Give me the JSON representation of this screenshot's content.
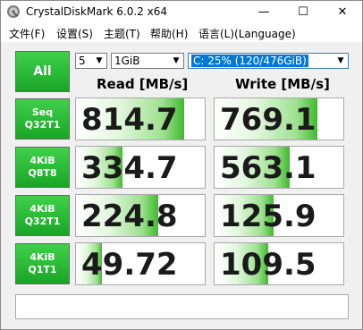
{
  "window": {
    "title": "CrystalDiskMark 6.0.2 x64"
  },
  "titlebar_buttons": {
    "minimize": "—",
    "maximize": "☐",
    "close": "✕"
  },
  "menu": [
    "文件(F)",
    "设置(S)",
    "主题(T)",
    "帮助(H)",
    "语言(L)(Language)"
  ],
  "controls": {
    "all_label": "All",
    "count": "5",
    "size": "1GiB",
    "drive": "C: 25% (120/476GiB)"
  },
  "headers": {
    "read": "Read [MB/s]",
    "write": "Write [MB/s]"
  },
  "tests": [
    {
      "line1": "Seq",
      "line2": "Q32T1",
      "read": "814.7",
      "write": "769.1",
      "read_fill": 0.84,
      "write_fill": 0.8
    },
    {
      "line1": "4KiB",
      "line2": "Q8T8",
      "read": "334.7",
      "write": "563.1",
      "read_fill": 0.36,
      "write_fill": 0.58
    },
    {
      "line1": "4KiB",
      "line2": "Q32T1",
      "read": "224.8",
      "write": "125.9",
      "read_fill": 0.64,
      "write_fill": 0.46
    },
    {
      "line1": "4KiB",
      "line2": "Q1T1",
      "read": "49.72",
      "write": "109.5",
      "read_fill": 0.2,
      "write_fill": 0.42
    }
  ],
  "comment": ""
}
